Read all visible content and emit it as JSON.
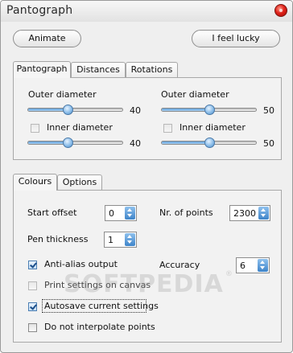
{
  "window": {
    "title": "Pantograph"
  },
  "buttons": {
    "animate": "Animate",
    "lucky": "I feel lucky"
  },
  "tabs_top": [
    {
      "label": "Pantograph",
      "active": true
    },
    {
      "label": "Distances",
      "active": false
    },
    {
      "label": "Rotations",
      "active": false
    }
  ],
  "pantograph": {
    "outer_left": {
      "label": "Outer diameter",
      "value": "40",
      "fraction": 0.42
    },
    "inner_left": {
      "label": "Inner diameter",
      "checked": false,
      "value": "40",
      "fraction": 0.42
    },
    "outer_right": {
      "label": "Outer diameter",
      "value": "50",
      "fraction": 0.5
    },
    "inner_right": {
      "label": "Inner diameter",
      "checked": false,
      "value": "50",
      "fraction": 0.5
    }
  },
  "tabs_bottom": [
    {
      "label": "Colours",
      "active": true
    },
    {
      "label": "Options",
      "active": false
    }
  ],
  "options": {
    "start_offset": {
      "label": "Start offset",
      "value": "0"
    },
    "nr_points": {
      "label": "Nr. of points",
      "value": "2300"
    },
    "pen_thickness": {
      "label": "Pen thickness",
      "value": "1"
    },
    "accuracy": {
      "label": "Accuracy",
      "value": "6"
    },
    "anti_alias": {
      "label": "Anti-alias output",
      "checked": true
    },
    "print_settings": {
      "label": "Print settings on canvas",
      "checked": false,
      "disabled": true
    },
    "autosave": {
      "label": "Autosave current settings",
      "checked": true
    },
    "no_interpolate": {
      "label": "Do not interpolate points",
      "checked": false
    }
  },
  "watermark": {
    "text": "SOFTPEDIA",
    "mark": "®"
  },
  "colors": {
    "slider_fill": "#6aa8e0",
    "close_button": "#e0231b"
  }
}
